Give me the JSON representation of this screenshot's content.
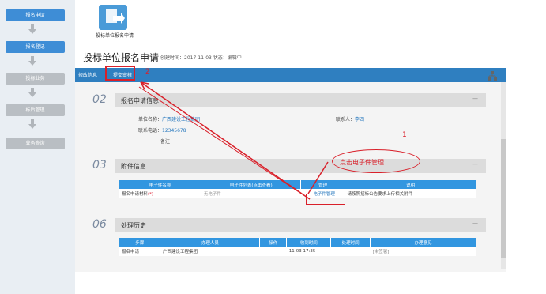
{
  "sidebar": {
    "steps": [
      {
        "label": "报名申请",
        "state": "active"
      },
      {
        "label": "报名登记",
        "state": "active"
      },
      {
        "label": "投标业务",
        "state": "inactive"
      },
      {
        "label": "标后管理",
        "state": "inactive"
      },
      {
        "label": "业务查询",
        "state": "inactive"
      }
    ]
  },
  "top": {
    "icon_label": "投标单位报名申请"
  },
  "header": {
    "title": "投标单位报名申请",
    "meta": "创建时间：2017-11-03  状态：编辑中"
  },
  "toolbar": {
    "edit_label": "修改信息",
    "submit_label": "提交审核"
  },
  "sections": {
    "s02": {
      "num": "02",
      "title": "报名申请信息",
      "unit_label": "单位名称：",
      "unit_value": "广西建设工程集团",
      "contact_label": "联系人：",
      "contact_value": "李四",
      "phone_label": "联系电话：",
      "phone_value": "12345678",
      "remark_label": "备注："
    },
    "s03": {
      "num": "03",
      "title": "附件信息",
      "headers": [
        "电子件名称",
        "电子件列表(点击查看)",
        "管理",
        "说明"
      ],
      "row": {
        "name": "报名申请材料",
        "required": "(*)",
        "list": "无电子件",
        "manage": "电子件管理",
        "desc": "请按照招标公告要求上传相关附件"
      }
    },
    "s06": {
      "num": "06",
      "title": "处理历史",
      "headers": [
        "步骤",
        "办理人员",
        "操作",
        "收到时间",
        "处理时间",
        "办理意见"
      ],
      "row": {
        "step": "报名申请",
        "person": "广西建设工程集团",
        "op": "",
        "recv": "11-03 17:35",
        "proc": "",
        "opinion": "[未签署]"
      }
    }
  },
  "annotations": {
    "callout_text": "点击电子件管理",
    "num1": "1",
    "num2": "2"
  },
  "colors": {
    "accent": "#2f7fc0",
    "annotation": "#d9202a",
    "header_blue": "#3296e0"
  }
}
